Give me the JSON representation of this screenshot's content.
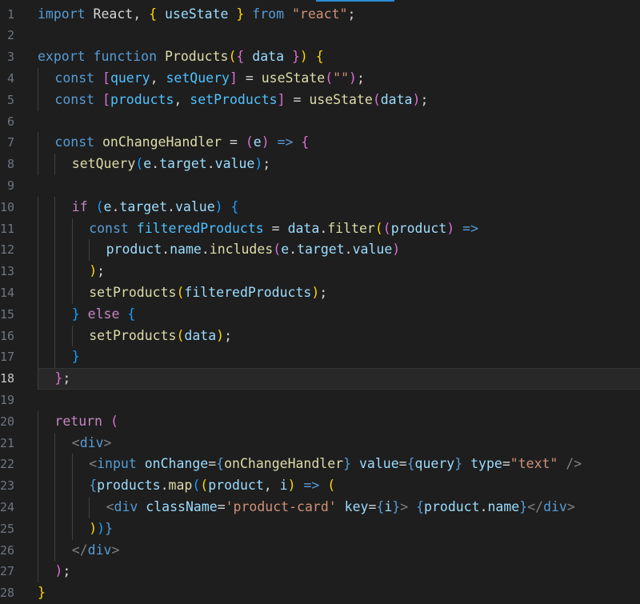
{
  "editor": {
    "lines": [
      {
        "n": "1",
        "indent": 0,
        "tokens": [
          [
            "kw",
            "import"
          ],
          [
            "p",
            " React, "
          ],
          [
            "br1",
            "{"
          ],
          [
            "p",
            " "
          ],
          [
            "var",
            "useState"
          ],
          [
            "p",
            " "
          ],
          [
            "br1",
            "}"
          ],
          [
            "p",
            " "
          ],
          [
            "kw",
            "from"
          ],
          [
            "p",
            " "
          ],
          [
            "str",
            "\"react\""
          ],
          [
            "p",
            ";"
          ]
        ]
      },
      {
        "n": "2",
        "indent": 0,
        "tokens": []
      },
      {
        "n": "3",
        "indent": 0,
        "tokens": [
          [
            "kw",
            "export"
          ],
          [
            "p",
            " "
          ],
          [
            "kw",
            "function"
          ],
          [
            "p",
            " "
          ],
          [
            "fn",
            "Products"
          ],
          [
            "br1",
            "("
          ],
          [
            "br2",
            "{"
          ],
          [
            "p",
            " "
          ],
          [
            "var",
            "data"
          ],
          [
            "p",
            " "
          ],
          [
            "br2",
            "}"
          ],
          [
            "br1",
            ")"
          ],
          [
            "p",
            " "
          ],
          [
            "br1",
            "{"
          ]
        ]
      },
      {
        "n": "4",
        "indent": 1,
        "tokens": [
          [
            "kw",
            "const"
          ],
          [
            "p",
            " "
          ],
          [
            "br2",
            "["
          ],
          [
            "cst",
            "query"
          ],
          [
            "p",
            ", "
          ],
          [
            "cst",
            "setQuery"
          ],
          [
            "br2",
            "]"
          ],
          [
            "p",
            " = "
          ],
          [
            "fn",
            "useState"
          ],
          [
            "br2",
            "("
          ],
          [
            "str",
            "\"\""
          ],
          [
            "br2",
            ")"
          ],
          [
            "p",
            ";"
          ]
        ]
      },
      {
        "n": "5",
        "indent": 1,
        "tokens": [
          [
            "kw",
            "const"
          ],
          [
            "p",
            " "
          ],
          [
            "br2",
            "["
          ],
          [
            "cst",
            "products"
          ],
          [
            "p",
            ", "
          ],
          [
            "cst",
            "setProducts"
          ],
          [
            "br2",
            "]"
          ],
          [
            "p",
            " = "
          ],
          [
            "fn",
            "useState"
          ],
          [
            "br2",
            "("
          ],
          [
            "var",
            "data"
          ],
          [
            "br2",
            ")"
          ],
          [
            "p",
            ";"
          ]
        ]
      },
      {
        "n": "6",
        "indent": 0,
        "tokens": []
      },
      {
        "n": "7",
        "indent": 1,
        "tokens": [
          [
            "kw",
            "const"
          ],
          [
            "p",
            " "
          ],
          [
            "fn",
            "onChangeHandler"
          ],
          [
            "p",
            " = "
          ],
          [
            "br2",
            "("
          ],
          [
            "var",
            "e"
          ],
          [
            "br2",
            ")"
          ],
          [
            "p",
            " "
          ],
          [
            "kw",
            "=>"
          ],
          [
            "p",
            " "
          ],
          [
            "br2",
            "{"
          ]
        ]
      },
      {
        "n": "8",
        "indent": 2,
        "tokens": [
          [
            "fn",
            "setQuery"
          ],
          [
            "br3",
            "("
          ],
          [
            "var",
            "e"
          ],
          [
            "p",
            "."
          ],
          [
            "var",
            "target"
          ],
          [
            "p",
            "."
          ],
          [
            "var",
            "value"
          ],
          [
            "br3",
            ")"
          ],
          [
            "p",
            ";"
          ]
        ]
      },
      {
        "n": "9",
        "indent": 0,
        "tokens": []
      },
      {
        "n": "10",
        "indent": 2,
        "tokens": [
          [
            "ctl",
            "if"
          ],
          [
            "p",
            " "
          ],
          [
            "br3",
            "("
          ],
          [
            "var",
            "e"
          ],
          [
            "p",
            "."
          ],
          [
            "var",
            "target"
          ],
          [
            "p",
            "."
          ],
          [
            "var",
            "value"
          ],
          [
            "br3",
            ")"
          ],
          [
            "p",
            " "
          ],
          [
            "br3",
            "{"
          ]
        ]
      },
      {
        "n": "11",
        "indent": 3,
        "tokens": [
          [
            "kw",
            "const"
          ],
          [
            "p",
            " "
          ],
          [
            "cst",
            "filteredProducts"
          ],
          [
            "p",
            " = "
          ],
          [
            "var",
            "data"
          ],
          [
            "p",
            "."
          ],
          [
            "fn",
            "filter"
          ],
          [
            "br1",
            "("
          ],
          [
            "br2",
            "("
          ],
          [
            "var",
            "product"
          ],
          [
            "br2",
            ")"
          ],
          [
            "p",
            " "
          ],
          [
            "kw",
            "=>"
          ]
        ]
      },
      {
        "n": "12",
        "indent": 4,
        "tokens": [
          [
            "var",
            "product"
          ],
          [
            "p",
            "."
          ],
          [
            "var",
            "name"
          ],
          [
            "p",
            "."
          ],
          [
            "fn",
            "includes"
          ],
          [
            "br2",
            "("
          ],
          [
            "var",
            "e"
          ],
          [
            "p",
            "."
          ],
          [
            "var",
            "target"
          ],
          [
            "p",
            "."
          ],
          [
            "var",
            "value"
          ],
          [
            "br2",
            ")"
          ]
        ]
      },
      {
        "n": "13",
        "indent": 3,
        "tokens": [
          [
            "br1",
            ")"
          ],
          [
            "p",
            ";"
          ]
        ]
      },
      {
        "n": "14",
        "indent": 3,
        "tokens": [
          [
            "fn",
            "setProducts"
          ],
          [
            "br1",
            "("
          ],
          [
            "var",
            "filteredProducts"
          ],
          [
            "br1",
            ")"
          ],
          [
            "p",
            ";"
          ]
        ]
      },
      {
        "n": "15",
        "indent": 2,
        "tokens": [
          [
            "br3",
            "}"
          ],
          [
            "p",
            " "
          ],
          [
            "ctl",
            "else"
          ],
          [
            "p",
            " "
          ],
          [
            "br3",
            "{"
          ]
        ]
      },
      {
        "n": "16",
        "indent": 3,
        "tokens": [
          [
            "fn",
            "setProducts"
          ],
          [
            "br1",
            "("
          ],
          [
            "var",
            "data"
          ],
          [
            "br1",
            ")"
          ],
          [
            "p",
            ";"
          ]
        ]
      },
      {
        "n": "17",
        "indent": 2,
        "tokens": [
          [
            "br3",
            "}"
          ]
        ]
      },
      {
        "n": "18",
        "indent": 1,
        "tokens": [
          [
            "br2",
            "}"
          ],
          [
            "p",
            ";"
          ]
        ],
        "active": true
      },
      {
        "n": "19",
        "indent": 0,
        "tokens": []
      },
      {
        "n": "20",
        "indent": 1,
        "tokens": [
          [
            "ctl",
            "return"
          ],
          [
            "p",
            " "
          ],
          [
            "br2",
            "("
          ]
        ]
      },
      {
        "n": "21",
        "indent": 2,
        "tokens": [
          [
            "pun",
            "<"
          ],
          [
            "tag",
            "div"
          ],
          [
            "pun",
            ">"
          ]
        ]
      },
      {
        "n": "22",
        "indent": 3,
        "tokens": [
          [
            "pun",
            "<"
          ],
          [
            "tag",
            "input"
          ],
          [
            "p",
            " "
          ],
          [
            "var",
            "onChange"
          ],
          [
            "p",
            "="
          ],
          [
            "kw",
            "{"
          ],
          [
            "fn",
            "onChangeHandler"
          ],
          [
            "kw",
            "}"
          ],
          [
            "p",
            " "
          ],
          [
            "var",
            "value"
          ],
          [
            "p",
            "="
          ],
          [
            "kw",
            "{"
          ],
          [
            "var",
            "query"
          ],
          [
            "kw",
            "}"
          ],
          [
            "p",
            " "
          ],
          [
            "var",
            "type"
          ],
          [
            "p",
            "="
          ],
          [
            "str",
            "\"text\""
          ],
          [
            "p",
            " "
          ],
          [
            "pun",
            "/>"
          ]
        ]
      },
      {
        "n": "23",
        "indent": 3,
        "tokens": [
          [
            "kw",
            "{"
          ],
          [
            "var",
            "products"
          ],
          [
            "p",
            "."
          ],
          [
            "fn",
            "map"
          ],
          [
            "br3",
            "("
          ],
          [
            "br1",
            "("
          ],
          [
            "var",
            "product"
          ],
          [
            "p",
            ", "
          ],
          [
            "var",
            "i"
          ],
          [
            "br1",
            ")"
          ],
          [
            "p",
            " "
          ],
          [
            "kw",
            "=>"
          ],
          [
            "p",
            " "
          ],
          [
            "br1",
            "("
          ]
        ]
      },
      {
        "n": "24",
        "indent": 4,
        "tokens": [
          [
            "pun",
            "<"
          ],
          [
            "tag",
            "div"
          ],
          [
            "p",
            " "
          ],
          [
            "var",
            "className"
          ],
          [
            "p",
            "="
          ],
          [
            "str",
            "'product-card'"
          ],
          [
            "p",
            " "
          ],
          [
            "var",
            "key"
          ],
          [
            "p",
            "="
          ],
          [
            "kw",
            "{"
          ],
          [
            "var",
            "i"
          ],
          [
            "kw",
            "}"
          ],
          [
            "pun",
            ">"
          ],
          [
            "p",
            " "
          ],
          [
            "kw",
            "{"
          ],
          [
            "var",
            "product"
          ],
          [
            "p",
            "."
          ],
          [
            "var",
            "name"
          ],
          [
            "kw",
            "}"
          ],
          [
            "pun",
            "</"
          ],
          [
            "tag",
            "div"
          ],
          [
            "pun",
            ">"
          ]
        ]
      },
      {
        "n": "25",
        "indent": 3,
        "tokens": [
          [
            "br1",
            ")"
          ],
          [
            "br3",
            ")"
          ],
          [
            "kw",
            "}"
          ]
        ]
      },
      {
        "n": "26",
        "indent": 2,
        "tokens": [
          [
            "pun",
            "</"
          ],
          [
            "tag",
            "div"
          ],
          [
            "pun",
            ">"
          ]
        ]
      },
      {
        "n": "27",
        "indent": 1,
        "tokens": [
          [
            "br2",
            ")"
          ],
          [
            "p",
            ";"
          ]
        ]
      },
      {
        "n": "28",
        "indent": 0,
        "tokens": [
          [
            "br1",
            "}"
          ]
        ]
      }
    ]
  }
}
